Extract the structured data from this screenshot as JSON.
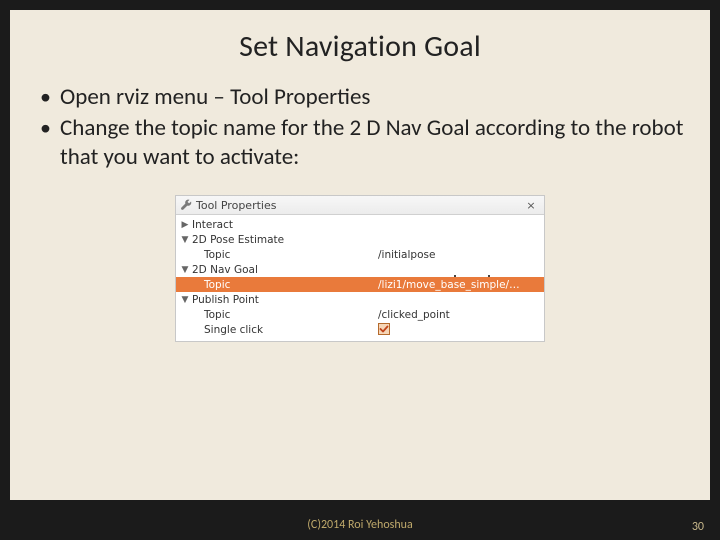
{
  "title": "Set Navigation Goal",
  "bullets": [
    "Open rviz menu – Tool Properties",
    "Change the topic name for the 2 D Nav Goal according to the robot that you want to activate:"
  ],
  "panel": {
    "header": "Tool Properties",
    "close": "×",
    "rows": [
      {
        "kind": "group",
        "expanded": false,
        "label": "Interact",
        "value": ""
      },
      {
        "kind": "group",
        "expanded": true,
        "label": "2D Pose Estimate",
        "value": ""
      },
      {
        "kind": "child",
        "label": "Topic",
        "value": "/initialpose"
      },
      {
        "kind": "group",
        "expanded": true,
        "label": "2D Nav Goal",
        "value": ""
      },
      {
        "kind": "child",
        "selected": true,
        "label": "Topic",
        "value": "/lizi1/move_base_simple/…"
      },
      {
        "kind": "group",
        "expanded": true,
        "label": "Publish Point",
        "value": ""
      },
      {
        "kind": "child",
        "label": "Topic",
        "value": "/clicked_point"
      },
      {
        "kind": "child",
        "label": "Single click",
        "value": "",
        "checkbox": true
      }
    ]
  },
  "footer": {
    "copyright": "(C)2014 Roi Yehoshua",
    "page": "30"
  },
  "glyphs": {
    "right": "▶",
    "down": "▼"
  }
}
